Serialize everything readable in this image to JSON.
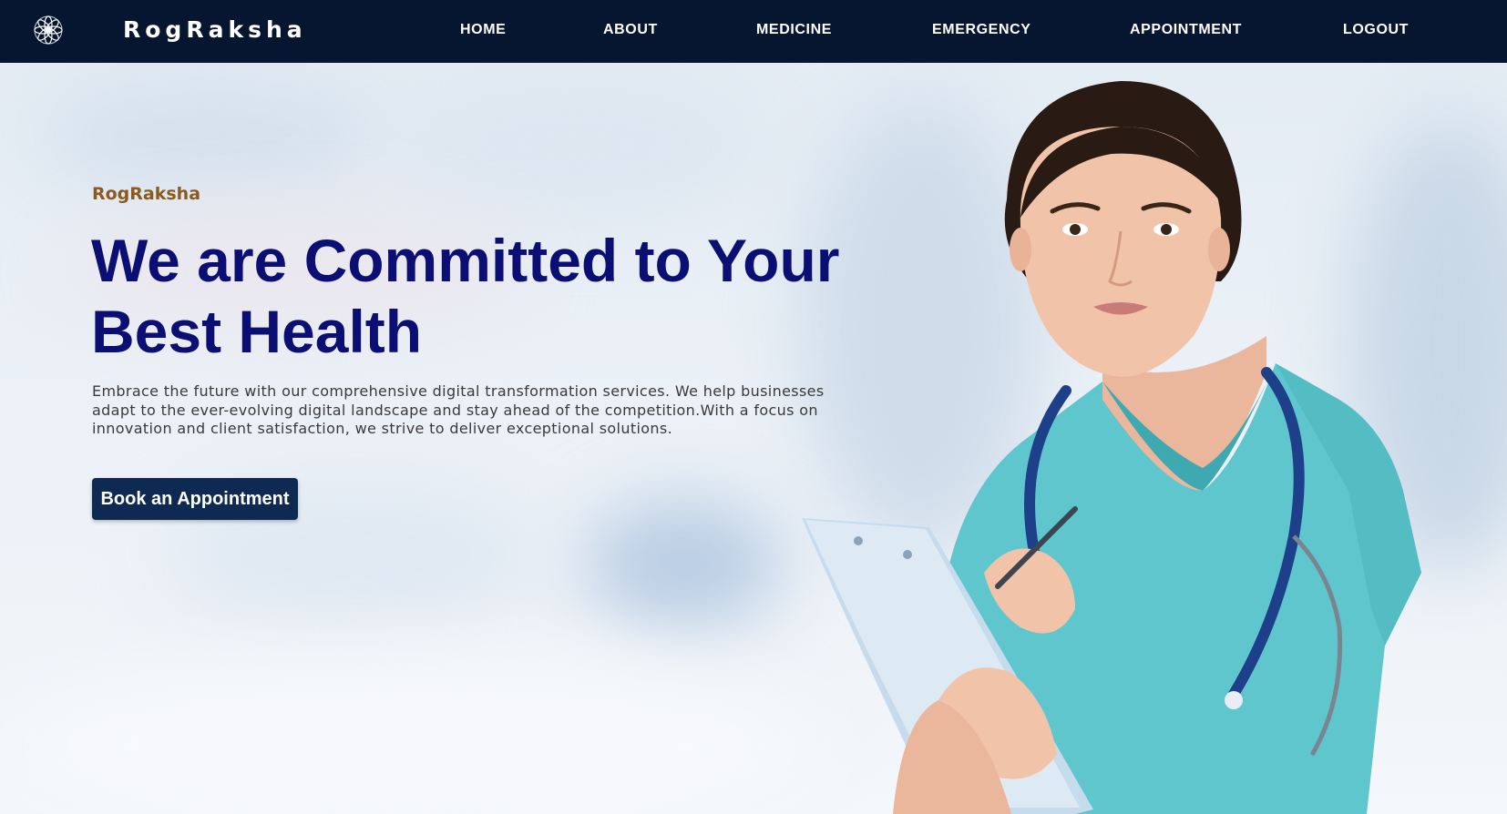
{
  "navbar": {
    "brand": "RogRaksha",
    "logo_icon": "mandala-logo-icon",
    "links": [
      {
        "label": "HOME"
      },
      {
        "label": "ABOUT"
      },
      {
        "label": "MEDICINE"
      },
      {
        "label": "EMERGENCY"
      },
      {
        "label": "APPOINTMENT"
      },
      {
        "label": "LOGOUT"
      }
    ]
  },
  "hero": {
    "kicker": "RogRaksha",
    "headline_line1": "We are Committed to Your",
    "headline_line2": "Best Health",
    "description": "Embrace the future with our comprehensive digital transformation services. We help businesses adapt to the ever-evolving digital landscape and stay ahead of the competition.With a focus on innovation and client satisfaction, we strive to deliver exceptional solutions.",
    "cta_label": "Book an Appointment",
    "image": "nurse-with-clipboard-illustration"
  },
  "colors": {
    "navbar_bg": "#071630",
    "headline": "#0b0f73",
    "kicker": "#8a5a1f",
    "cta_bg": "#0f2a52",
    "scrubs": "#5ec6cc"
  }
}
